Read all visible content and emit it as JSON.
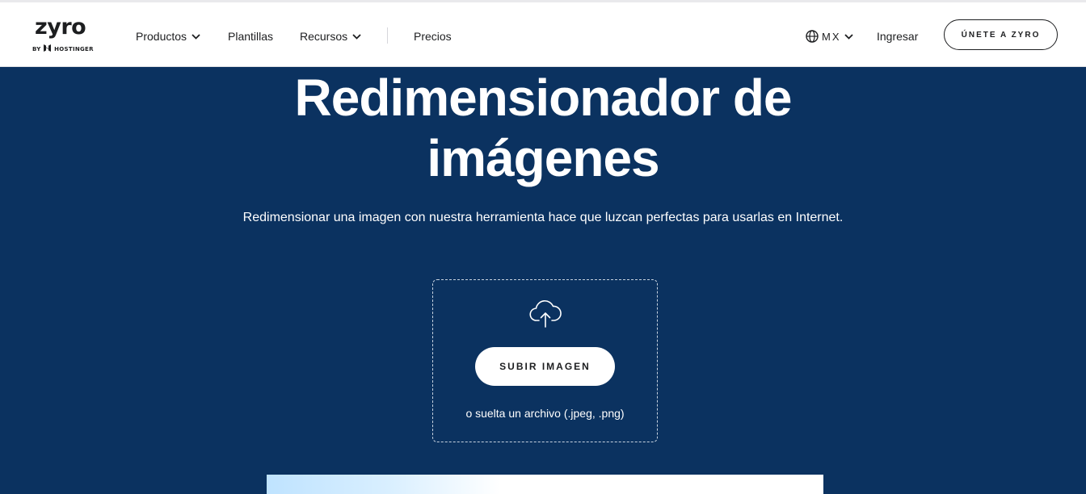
{
  "header": {
    "logo": {
      "word": "zyro",
      "by_text": "BY",
      "brand_text": "HOSTINGER"
    },
    "nav": [
      {
        "label": "Productos",
        "has_dropdown": true
      },
      {
        "label": "Plantillas",
        "has_dropdown": false
      },
      {
        "label": "Recursos",
        "has_dropdown": true
      },
      {
        "label": "Precios",
        "has_dropdown": false
      }
    ],
    "language": {
      "label": "MX",
      "icon": "globe-icon"
    },
    "login_label": "Ingresar",
    "join_label": "ÚNETE A ZYRO"
  },
  "hero": {
    "title_line1": "Redimensionador de",
    "title_line2": "imágenes",
    "subtitle": "Redimensionar una imagen con nuestra herramienta hace que luzcan perfectas para usarlas en Internet."
  },
  "upload": {
    "icon": "cloud-upload-icon",
    "button_label": "SUBIR IMAGEN",
    "hint": "o suelta un archivo (.jpeg, .png)"
  },
  "colors": {
    "hero_background": "#0b3260",
    "header_background": "#ffffff",
    "text_dark": "#1d1e20"
  }
}
